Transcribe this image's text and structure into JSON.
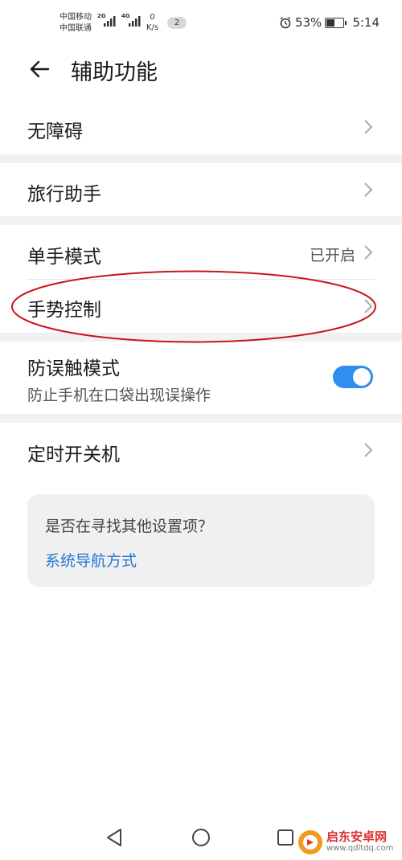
{
  "status_bar": {
    "carrier1": "中国移动",
    "carrier2": "中国联通",
    "sig1": "2G",
    "sig2": "4G",
    "speed_value": "0",
    "speed_unit": "K/s",
    "notif_count": "2",
    "battery": "53%",
    "battery_level": 0.53,
    "time": "5:14"
  },
  "header": {
    "title": "辅助功能"
  },
  "items": {
    "accessibility": "无障碍",
    "travel": "旅行助手",
    "onehand": "单手模式",
    "onehand_value": "已开启",
    "gesture": "手势控制",
    "mistouch": "防误触模式",
    "mistouch_sub": "防止手机在口袋出现误操作",
    "mistouch_on": true,
    "schedule": "定时开关机"
  },
  "suggest": {
    "question": "是否在寻找其他设置项？",
    "link": "系统导航方式"
  },
  "watermark": {
    "brand": "启东安卓网",
    "url": "www.qdltdq.com"
  },
  "colors": {
    "accent": "#2f8ef0",
    "annotation": "#c8151b"
  }
}
